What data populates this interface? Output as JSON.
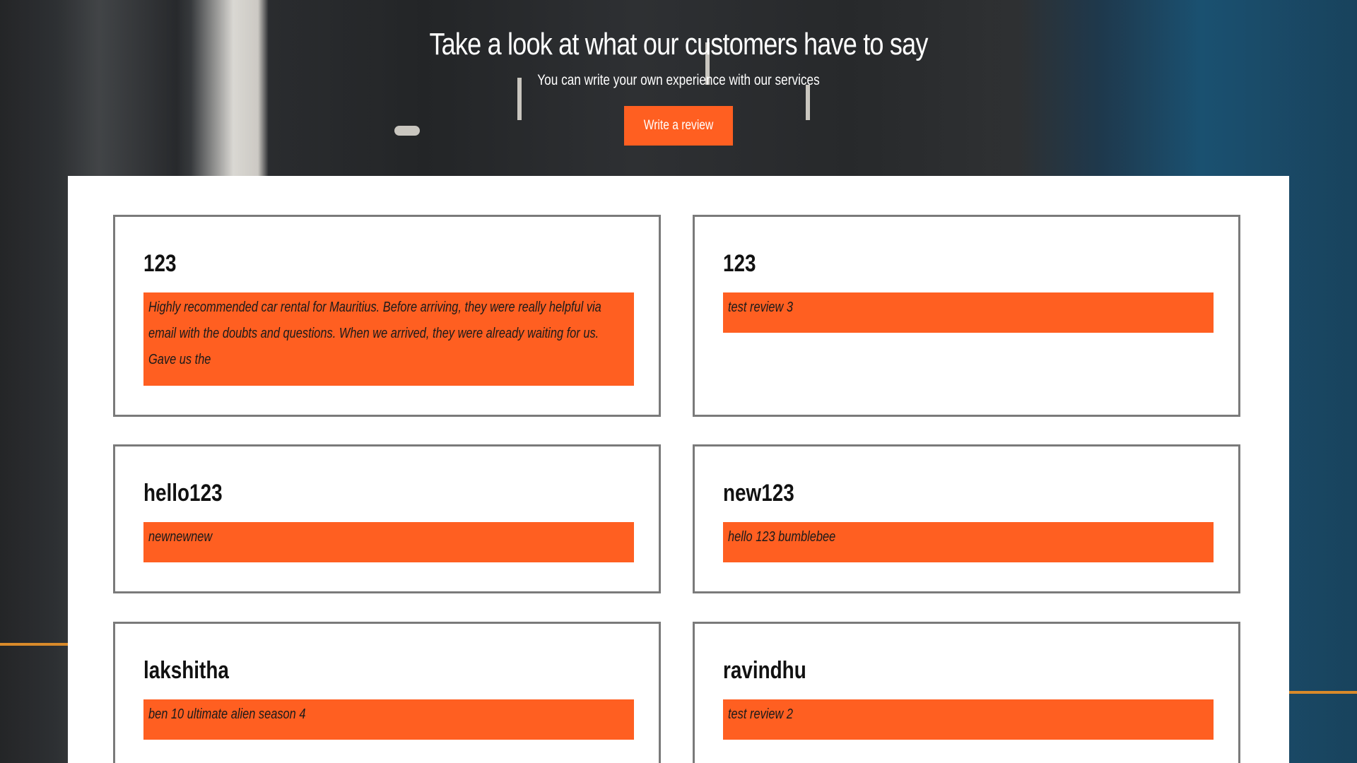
{
  "hero": {
    "title": "Take a look at what our customers have to say",
    "subtitle": "You can write your own experience with our services",
    "write_review_label": "Write a review"
  },
  "colors": {
    "accent": "#ff5f21",
    "card_border": "#7a7a7a",
    "panel_bg": "#ffffff"
  },
  "reviews": [
    {
      "name": "123",
      "text": "Highly recommended car rental for Mauritius. Before arriving, they were really helpful via email with the doubts and questions. When we arrived, they were already waiting for us. Gave us the"
    },
    {
      "name": "123",
      "text": "test review 3"
    },
    {
      "name": "hello123",
      "text": "newnewnew"
    },
    {
      "name": "new123",
      "text": "hello 123 bumblebee"
    },
    {
      "name": "lakshitha",
      "text": "ben 10 ultimate alien season 4"
    },
    {
      "name": "ravindhu",
      "text": "test review 2"
    }
  ]
}
